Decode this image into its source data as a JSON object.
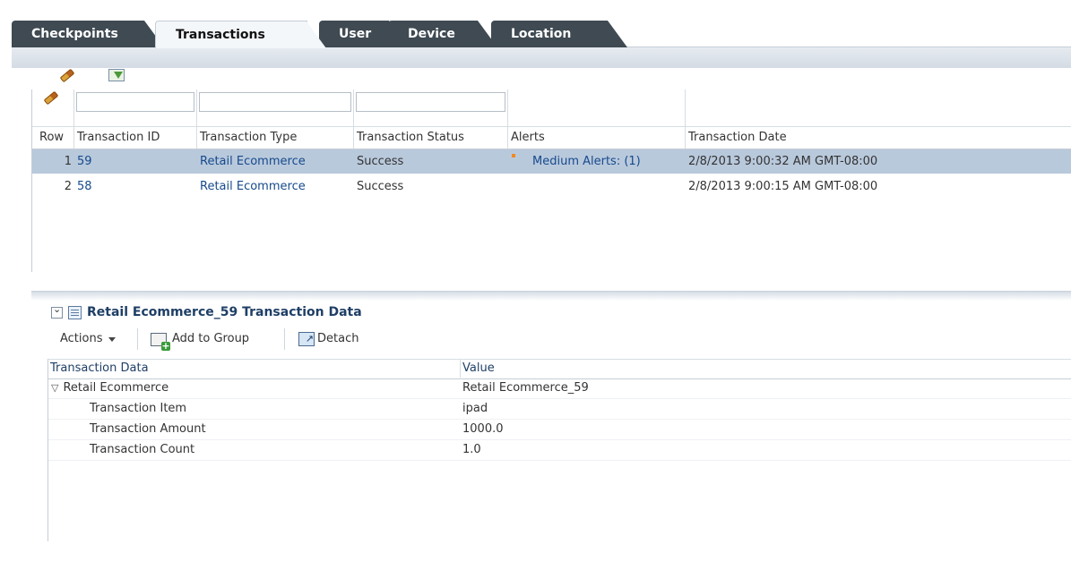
{
  "tabs": [
    {
      "label": "Checkpoints",
      "active": false
    },
    {
      "label": "Transactions",
      "active": true
    },
    {
      "label": "User",
      "active": false
    },
    {
      "label": "Device",
      "active": false
    },
    {
      "label": "Location",
      "active": false
    }
  ],
  "toolbar": {
    "clear_icon": "eraser-icon",
    "qbe_icon": "query-by-example-icon"
  },
  "transactions_table": {
    "columns": [
      "Row",
      "Transaction ID",
      "Transaction Type",
      "Transaction Status",
      "Alerts",
      "Transaction Date"
    ],
    "filters": {
      "transaction_id": "",
      "transaction_type": "",
      "transaction_status": ""
    },
    "rows": [
      {
        "row": "1",
        "id": "59",
        "type": "Retail Ecommerce",
        "status": "Success",
        "alerts": "Medium Alerts: (1)",
        "date": "2/8/2013 9:00:32 AM GMT-08:00",
        "selected": true
      },
      {
        "row": "2",
        "id": "58",
        "type": "Retail Ecommerce",
        "status": "Success",
        "alerts": "",
        "date": "2/8/2013 9:00:15 AM GMT-08:00",
        "selected": false
      }
    ]
  },
  "detail_panel": {
    "title": "Retail Ecommerce_59 Transaction Data",
    "actions_label": "Actions",
    "add_to_group_label": "Add to Group",
    "detach_label": "Detach",
    "columns": [
      "Transaction Data",
      "Value"
    ],
    "rows": [
      {
        "label": "Retail Ecommerce",
        "value": "Retail Ecommerce_59",
        "expanded": true
      },
      {
        "label": "Transaction Item",
        "value": "ipad"
      },
      {
        "label": "Transaction Amount",
        "value": "1000.0"
      },
      {
        "label": "Transaction Count",
        "value": "1.0"
      }
    ]
  },
  "colors": {
    "tab_dark": "#3f4a52",
    "selected_row": "#b9c9dc",
    "link": "#164a8c",
    "alert_marker": "#f08a1e",
    "panel_title": "#1f3f66"
  }
}
